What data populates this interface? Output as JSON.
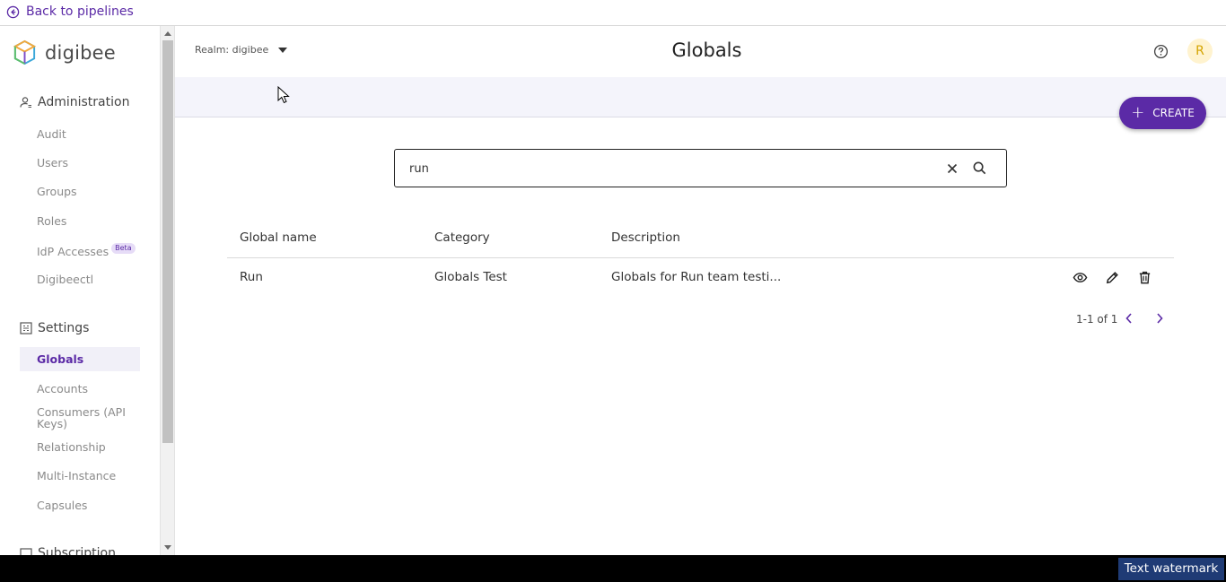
{
  "topbar": {
    "back_label": "Back to pipelines"
  },
  "brand": {
    "name": "digibee"
  },
  "sidebar": {
    "administration": {
      "title": "Administration",
      "items": [
        {
          "label": "Audit"
        },
        {
          "label": "Users"
        },
        {
          "label": "Groups"
        },
        {
          "label": "Roles"
        },
        {
          "label": "IdP Accesses",
          "badge": "Beta"
        },
        {
          "label": "Digibeectl"
        }
      ]
    },
    "settings": {
      "title": "Settings",
      "items": [
        {
          "label": "Globals",
          "active": true
        },
        {
          "label": "Accounts"
        },
        {
          "label": "Consumers (API Keys)"
        },
        {
          "label": "Relationship"
        },
        {
          "label": "Multi-Instance"
        },
        {
          "label": "Capsules"
        }
      ]
    },
    "subscription": {
      "title": "Subscription"
    }
  },
  "header": {
    "realm_label": "Realm: digibee",
    "title": "Globals",
    "avatar_initial": "R"
  },
  "toolbar": {
    "create_label": "CREATE"
  },
  "search": {
    "value": "run"
  },
  "table": {
    "columns": [
      "Global name",
      "Category",
      "Description"
    ],
    "rows": [
      {
        "name": "Run",
        "category": "Globals Test",
        "description": "Globals for Run team testi..."
      }
    ]
  },
  "pagination": {
    "text": "1-1 of 1"
  },
  "footer": {
    "watermark": "Text watermark"
  },
  "colors": {
    "accent": "#5b2aa6",
    "band": "#f4f4fb",
    "avatar_bg": "#fff3cf"
  }
}
